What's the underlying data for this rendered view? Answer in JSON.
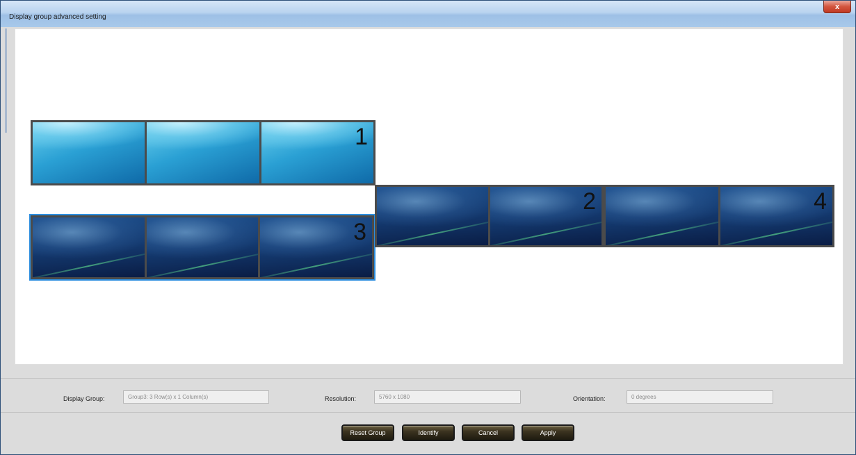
{
  "window": {
    "title": "Display group advanced setting",
    "close_glyph": "x"
  },
  "groups": [
    {
      "number": "1",
      "columns": 3,
      "theme": "light",
      "selected": false
    },
    {
      "number": "2",
      "columns": 2,
      "theme": "dark",
      "selected": false
    },
    {
      "number": "3",
      "columns": 3,
      "theme": "dark",
      "selected": true
    },
    {
      "number": "4",
      "columns": 2,
      "theme": "dark",
      "selected": false
    }
  ],
  "info": {
    "display_group_label": "Display Group:",
    "display_group_value": "Group3: 3 Row(s) x 1 Column(s)",
    "resolution_label": "Resolution:",
    "resolution_value": "5760 x 1080",
    "orientation_label": "Orientation:",
    "orientation_value": "0 degrees"
  },
  "buttons": {
    "reset": "Reset Group",
    "identify": "Identify",
    "cancel": "Cancel",
    "apply": "Apply"
  },
  "colors": {
    "selection": "#2d8fe0",
    "close": "#c13a24"
  }
}
